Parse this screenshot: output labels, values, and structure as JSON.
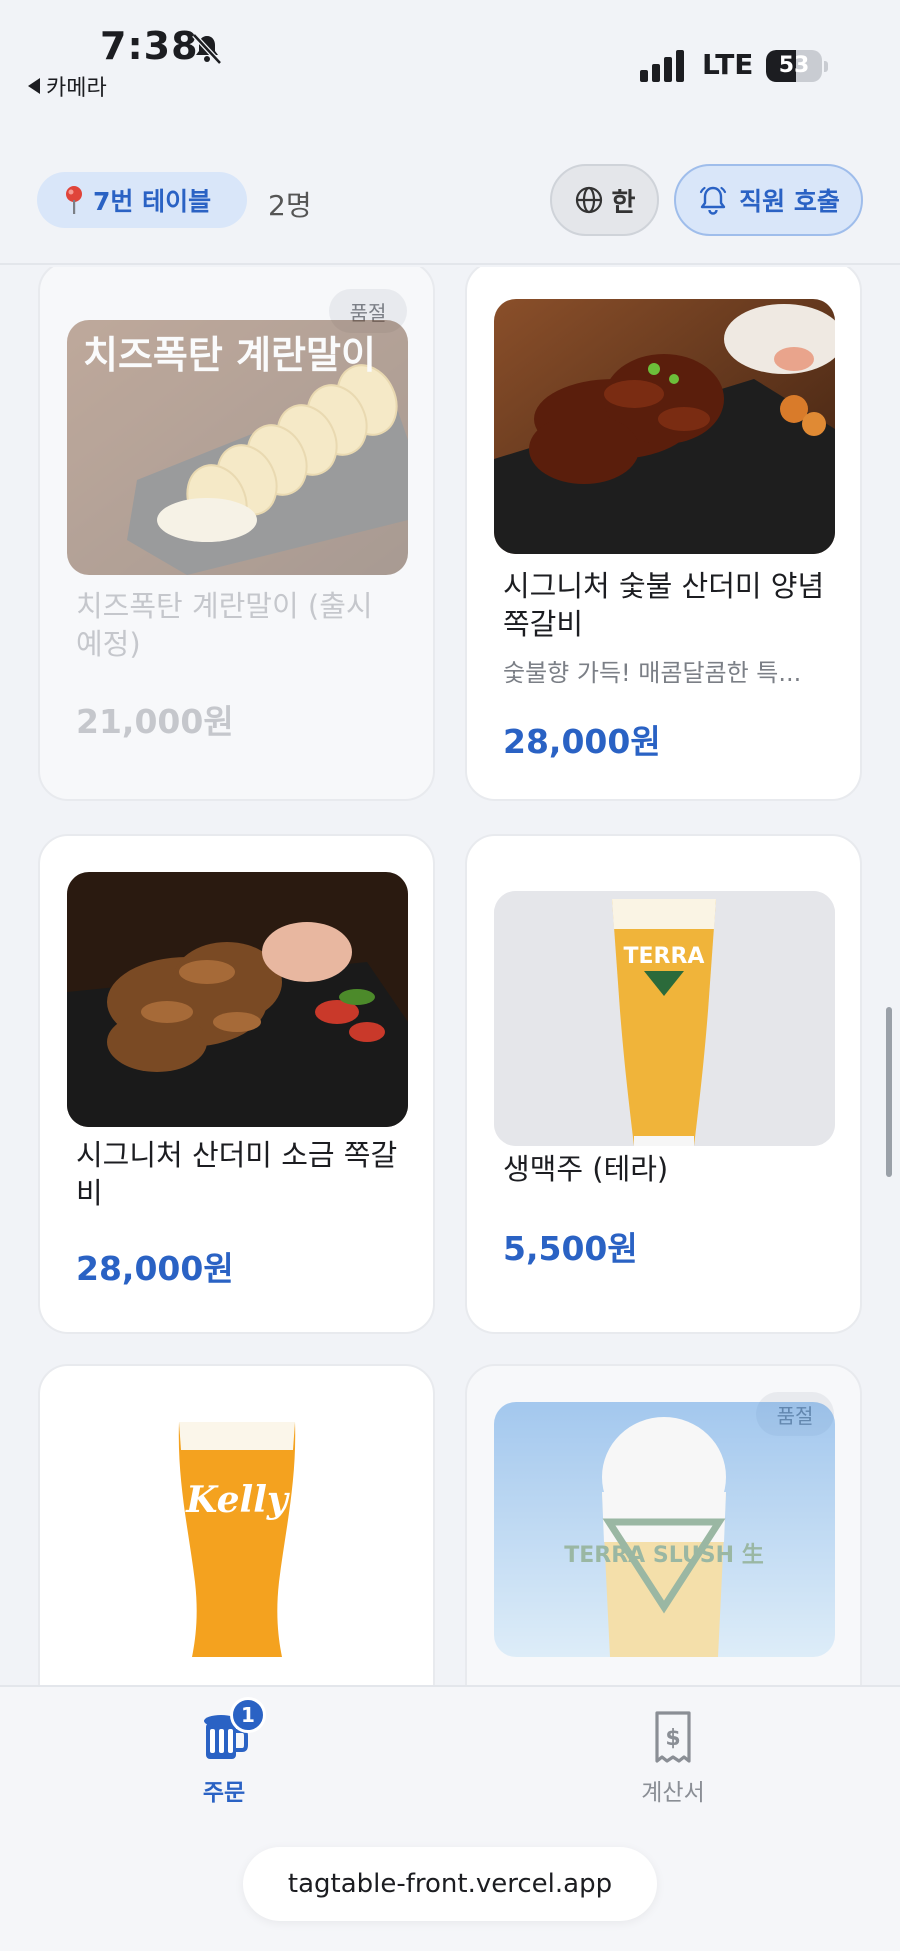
{
  "status_bar": {
    "time": "7:38",
    "back_app": "카메라",
    "network": "LTE",
    "battery": "53",
    "battery_level": 0.53,
    "icons": [
      "bell-slash-icon",
      "signal-icon",
      "battery-icon"
    ]
  },
  "header": {
    "table_label": "7번 테이블",
    "people": "2명",
    "language": "한",
    "call_staff": "직원 호출",
    "icons": [
      "map-pin-icon",
      "globe-icon",
      "bell-icon"
    ]
  },
  "menu": {
    "items": [
      {
        "name": "치즈폭탄 계란말이 (출시 예정)",
        "description": "",
        "price": "21,000원",
        "badge": "품절",
        "sold_out": true,
        "image": "rolled-omelette-photo",
        "image_text": "치즈폭탄\n계란말이"
      },
      {
        "name": "시그니처 숯불 산더미 양념 쪽갈비",
        "description": "숯불향 가득! 매콤달콤한 특...",
        "price": "28,000원",
        "badge": "",
        "sold_out": false,
        "image": "marinated-ribs-photo"
      },
      {
        "name": "시그니처 산더미 소금 쪽갈비",
        "description": "",
        "price": "28,000원",
        "badge": "",
        "sold_out": false,
        "image": "salt-ribs-photo"
      },
      {
        "name": "생맥주 (테라)",
        "description": "",
        "price": "5,500원",
        "badge": "",
        "sold_out": false,
        "image": "terra-beer-glass",
        "image_text": "TERRA"
      },
      {
        "name": "",
        "description": "",
        "price": "",
        "badge": "",
        "sold_out": false,
        "image": "kelly-beer-glass",
        "image_text": "Kelly"
      },
      {
        "name": "",
        "description": "",
        "price": "",
        "badge": "품절",
        "sold_out": true,
        "image": "terra-slush-photo",
        "image_text": "TERRA SLUSH 生"
      }
    ]
  },
  "bottom_nav": {
    "order_label": "주문",
    "order_badge": "1",
    "bill_label": "계산서",
    "icons": [
      "beer-mug-icon",
      "receipt-icon"
    ]
  },
  "browser": {
    "url": "tagtable-front.vercel.app"
  },
  "colors": {
    "accent": "#2a62c4",
    "accent_soft": "#d9e6f9",
    "background": "#f1f3f7",
    "card": "#ffffff",
    "muted": "#8a8e95"
  }
}
